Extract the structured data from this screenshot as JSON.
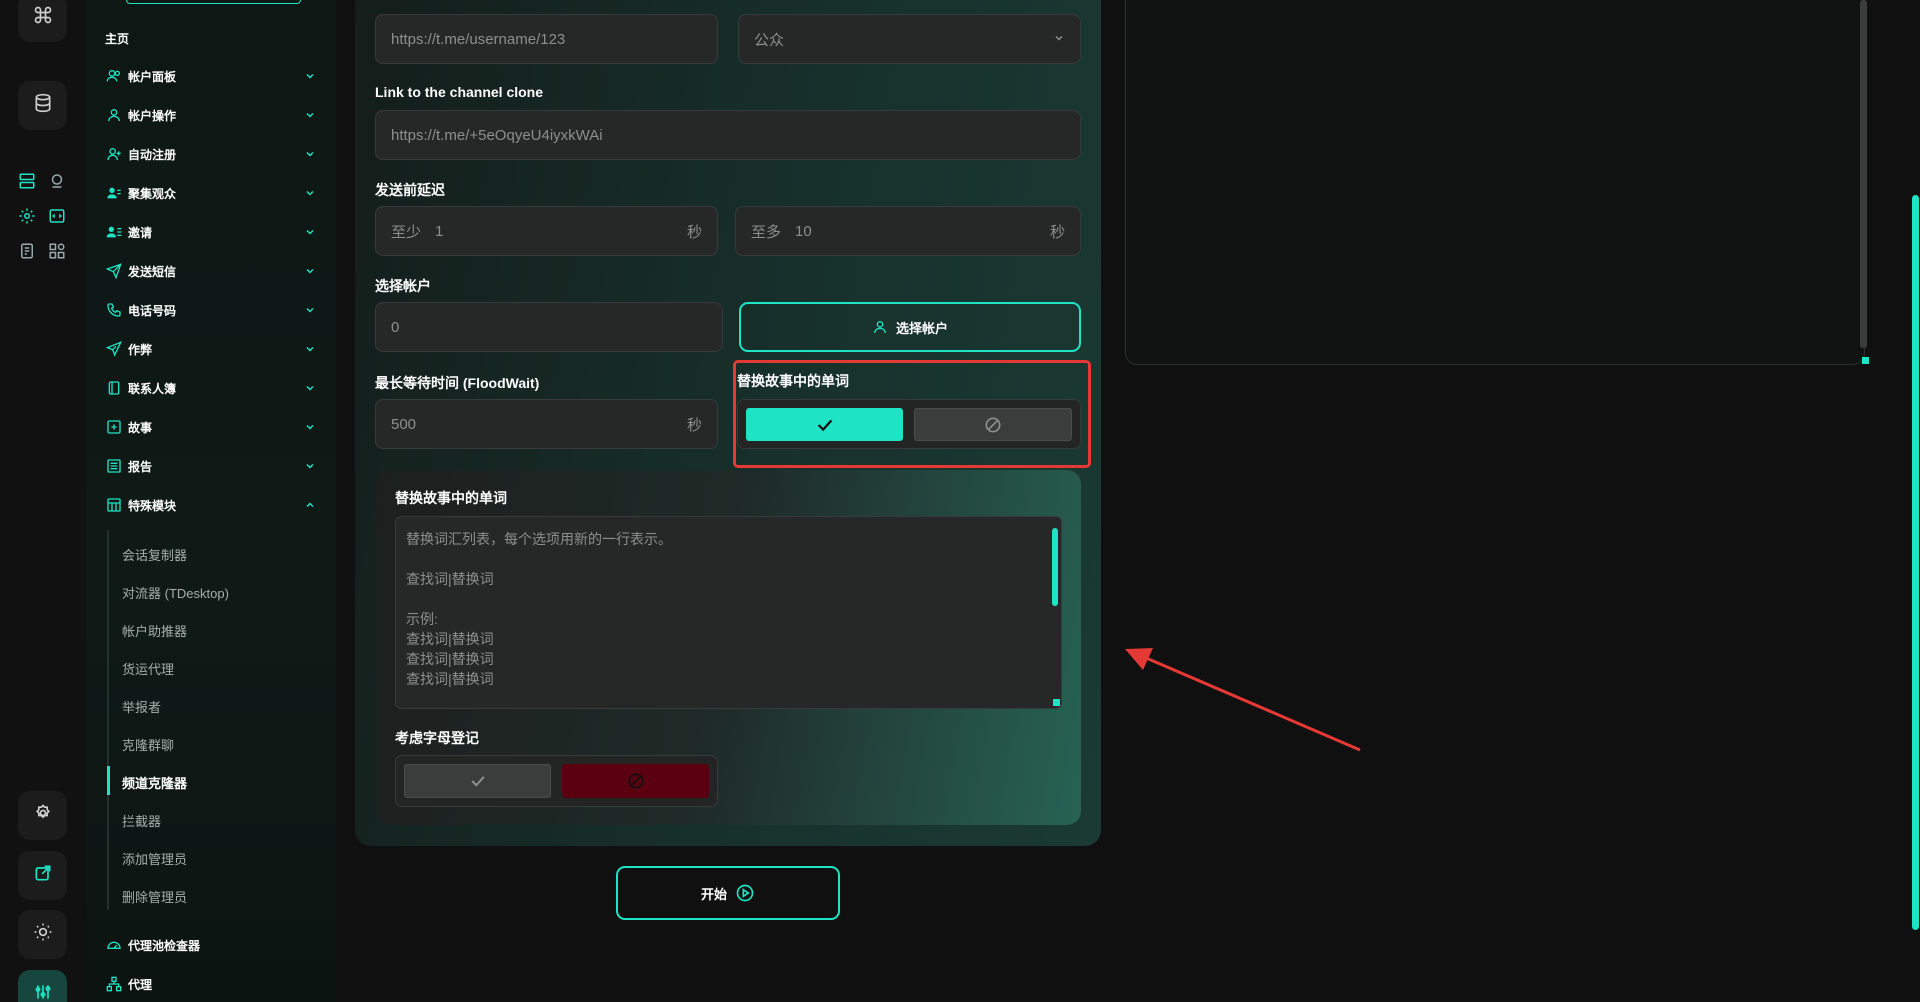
{
  "colors": {
    "accent": "#1ee3c4",
    "danger_dark": "#5a0010",
    "annotation": "#e53935"
  },
  "rail": {
    "icons": [
      "command-icon",
      "database-icon",
      "server-icon",
      "globe-pin-icon",
      "gear-icon",
      "code-window-icon",
      "document-icon",
      "apps-icon",
      "settings-icon",
      "external-link-icon",
      "sun-icon",
      "sliders-icon"
    ]
  },
  "sidebar": {
    "home": "主页",
    "items": [
      {
        "label": "帐户面板",
        "icon": "users-icon"
      },
      {
        "label": "帐户操作",
        "icon": "user-icon"
      },
      {
        "label": "自动注册",
        "icon": "user-plus-icon"
      },
      {
        "label": "聚集观众",
        "icon": "user-group-icon"
      },
      {
        "label": "邀请",
        "icon": "user-list-icon"
      },
      {
        "label": "发送短信",
        "icon": "send-icon"
      },
      {
        "label": "电话号码",
        "icon": "phone-icon"
      },
      {
        "label": "作弊",
        "icon": "rocket-send-icon"
      },
      {
        "label": "联系人簿",
        "icon": "book-icon"
      },
      {
        "label": "故事",
        "icon": "plus-square-icon"
      },
      {
        "label": "报告",
        "icon": "report-icon"
      },
      {
        "label": "特殊模块",
        "icon": "table-icon"
      }
    ],
    "sub_items": [
      "会话复制器",
      "对流器 (TDesktop)",
      "帐户助推器",
      "货运代理",
      "举报者",
      "克隆群聊",
      "频道克隆器",
      "拦截器",
      "添加管理员",
      "删除管理员"
    ],
    "active_sub": "频道克隆器",
    "bottom_items": [
      {
        "label": "代理池检查器",
        "icon": "gauge-icon"
      },
      {
        "label": "代理",
        "icon": "network-icon"
      }
    ]
  },
  "form": {
    "source_link_placeholder": "https://t.me/username/123",
    "type_select": "公众",
    "clone_link_label": "Link to the channel clone",
    "clone_link_placeholder": "https://t.me/+5eOqyeU4iyxkWAi",
    "delay_label": "发送前延迟",
    "delay_min_prefix": "至少",
    "delay_min": "1",
    "delay_max_prefix": "至多",
    "delay_max": "10",
    "unit_seconds": "秒",
    "accounts_label": "选择帐户",
    "accounts_count": "0",
    "choose_accounts_button": "选择帐户",
    "floodwait_label": "最长等待时间 (FloodWait)",
    "floodwait_value": "500",
    "replace_words_label": "替换故事中的单词",
    "replace_words_enabled": true,
    "replace_list_label": "替换故事中的单词",
    "replace_list_placeholder": "替换词汇列表，每个选项用新的一行表示。\n\n查找词|替换词\n\n示例:\n查找词|替换词\n查找词|替换词\n查找词|替换词\n\n要保替换单个词，请在词汇的开头和结尾使用空格。",
    "case_label": "考虑字母登记",
    "case_enabled": false,
    "start_button": "开始"
  }
}
